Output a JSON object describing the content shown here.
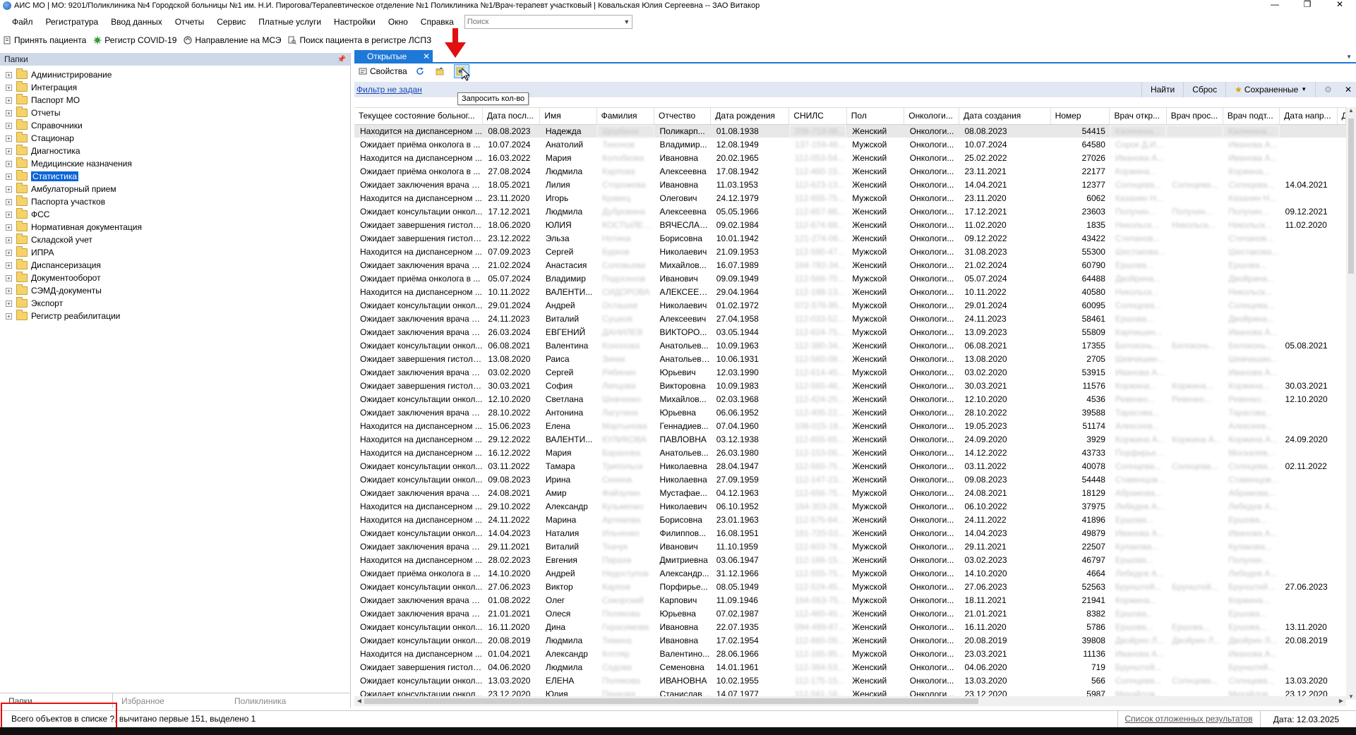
{
  "window": {
    "title": "АИС МО | МО: 9201/Поликлиника №4 Городской больницы №1 им. Н.И. Пирогова/Терапевтическое отделение №1 Поликлиника №1/Врач-терапевт участковый | Ковальская Юлия Сергеевна -- ЗАО Витакор",
    "minimize": "—",
    "maximize": "❐",
    "close": "✕"
  },
  "menu": {
    "items": [
      "Файл",
      "Регистратура",
      "Ввод данных",
      "Отчеты",
      "Сервис",
      "Платные услуги",
      "Настройки",
      "Окно",
      "Справка"
    ],
    "search_placeholder": "Поиск"
  },
  "quickbar": {
    "accept_patient": "Принять пациента",
    "covid_register": "Регистр COVID-19",
    "mse_referral": "Направление на МСЭ",
    "lspz_search": "Поиск пациента в регистре ЛСПЗ"
  },
  "left_pane": {
    "header": "Папки",
    "pin": "ᵖ",
    "folders": [
      "Администрирование",
      "Интеграция",
      "Паспорт МО",
      "Отчеты",
      "Справочники",
      "Стационар",
      "Диагностика",
      "Медицинские назначения",
      "Статистика",
      "Амбулаторный прием",
      "Паспорта участков",
      "ФСС",
      "Нормативная документация",
      "Складской учет",
      "ИПРА",
      "Диспансеризация",
      "Документооборот",
      "СЭМД-документы",
      "Экспорт",
      "Регистр реабилитации"
    ],
    "selected_folder": "Статистика",
    "tabs": [
      "Папки",
      "Избранное",
      "Поликлиника"
    ]
  },
  "right_pane": {
    "tab_label": "Открытые",
    "tab_close": "✕",
    "toolbar": {
      "properties": "Свойства",
      "tooltip": "Запросить кол-во"
    },
    "filter": {
      "link": "Фильтр не задан",
      "find": "Найти",
      "reset": "Сброс",
      "saved": "Сохраненные"
    },
    "columns": [
      "Текущее состояние больног...",
      "Дата посл...",
      "Имя",
      "Фамилия",
      "Отчество",
      "Дата рождения",
      "СНИЛС",
      "Пол",
      "Онкологи...",
      "Дата создания",
      "Номер",
      "Врач откр...",
      "Врач прос...",
      "Врач подт...",
      "Дата напр...",
      "Д"
    ],
    "rows": [
      [
        "Находится на диспансерном ...",
        "08.08.2023",
        "Надежда",
        "Щербина",
        "Поликарп...",
        "01.08.1938",
        "206-719-86...",
        "Женский",
        "Онкологи...",
        "08.08.2023",
        "54415",
        "Калинина...",
        "",
        "Калинина...",
        ""
      ],
      [
        "Ожидает приёма онколога в ...",
        "10.07.2024",
        "Анатолий",
        "Тихонов",
        "Владимир...",
        "12.08.1949",
        "137-159-46...",
        "Мужской",
        "Онкологи...",
        "10.07.2024",
        "64580",
        "Сорок Д.И...",
        "",
        "Иванова А...",
        ""
      ],
      [
        "Находится на диспансерном ...",
        "16.03.2022",
        "Мария",
        "Колобкова",
        "Ивановна",
        "20.02.1965",
        "112-053-54...",
        "Женский",
        "Онкологи...",
        "25.02.2022",
        "27026",
        "Иванова А...",
        "",
        "Иванова А...",
        ""
      ],
      [
        "Ожидает приёма онколога в ...",
        "27.08.2024",
        "Людмила",
        "Карпова",
        "Алексеевна",
        "17.08.1942",
        "112-460-15...",
        "Женский",
        "Онкологи...",
        "23.11.2021",
        "22177",
        "Коржина...",
        "",
        "Коржина...",
        ""
      ],
      [
        "Ожидает заключения врача п...",
        "18.05.2021",
        "Лилия",
        "Сторожева",
        "Ивановна",
        "11.03.1953",
        "112-623-13...",
        "Женский",
        "Онкологи...",
        "14.04.2021",
        "12377",
        "Солнцева...",
        "Солнцева...",
        "Солнцева...",
        "14.04.2021"
      ],
      [
        "Находится на диспансерном ...",
        "23.11.2020",
        "Игорь",
        "Кравец",
        "Олегович",
        "24.12.1979",
        "112-655-75...",
        "Мужской",
        "Онкологи...",
        "23.11.2020",
        "6062",
        "Казанин Н...",
        "",
        "Казанин Н...",
        ""
      ],
      [
        "Ожидает консультации онкол...",
        "17.12.2021",
        "Людмила",
        "Дубровина",
        "Алексеевна",
        "05.05.1966",
        "112-657-86...",
        "Женский",
        "Онкологи...",
        "17.12.2021",
        "23603",
        "Полухин...",
        "Полухин...",
        "Полухин...",
        "09.12.2021"
      ],
      [
        "Ожидает завершения гистоло...",
        "18.06.2020",
        "ЮЛИЯ",
        "КОСТЫЛЕВА",
        "ВЯЧЕСЛАВ...",
        "09.02.1984",
        "112-674-68...",
        "Женский",
        "Онкологи...",
        "11.02.2020",
        "1835",
        "Никольск...",
        "Никольск...",
        "Никольск...",
        "11.02.2020"
      ],
      [
        "Ожидает завершения гистоло...",
        "23.12.2022",
        "Эльза",
        "Нотина",
        "Борисовна",
        "10.01.1942",
        "121-274-06...",
        "Женский",
        "Онкологи...",
        "09.12.2022",
        "43422",
        "Степанов...",
        "",
        "Степанов...",
        ""
      ],
      [
        "Находится на диспансерном ...",
        "07.09.2023",
        "Сергей",
        "Бурков",
        "Николаевич",
        "21.09.1953",
        "112-580-47...",
        "Мужской",
        "Онкологи...",
        "31.08.2023",
        "55300",
        "Шестакова...",
        "",
        "Шестакова...",
        ""
      ],
      [
        "Ожидает заключения врача п...",
        "21.02.2024",
        "Анастасия",
        "Соловьева",
        "Михайлов...",
        "16.07.1989",
        "164-782-34...",
        "Женский",
        "Онкологи...",
        "21.02.2024",
        "60790",
        "Ершова...",
        "",
        "Ершова...",
        ""
      ],
      [
        "Ожидает приёма онколога в ...",
        "05.07.2024",
        "Владимир",
        "Подосенов",
        "Иванович",
        "09.09.1949",
        "112-566-70...",
        "Мужской",
        "Онкологи...",
        "05.07.2024",
        "64488",
        "Двойрина...",
        "",
        "Двойрина...",
        ""
      ],
      [
        "Находится на диспансерном ...",
        "10.11.2022",
        "ВАЛЕНТИ...",
        "СИДОРОВА",
        "АЛЕКСЕЕВ...",
        "29.04.1964",
        "112-188-13...",
        "Женский",
        "Онкологи...",
        "10.11.2022",
        "40580",
        "Никольск...",
        "",
        "Никольск...",
        ""
      ],
      [
        "Ожидает консультации онкол...",
        "29.01.2024",
        "Андрей",
        "Осташев",
        "Николаевич",
        "01.02.1972",
        "072-576-95...",
        "Мужской",
        "Онкологи...",
        "29.01.2024",
        "60095",
        "Солнцева...",
        "",
        "Солнцева...",
        ""
      ],
      [
        "Ожидает заключения врача п...",
        "24.11.2023",
        "Виталий",
        "Сушков",
        "Алексеевич",
        "27.04.1958",
        "112-033-52...",
        "Мужской",
        "Онкологи...",
        "24.11.2023",
        "58461",
        "Ершова...",
        "",
        "Двойрина...",
        ""
      ],
      [
        "Ожидает заключения врача п...",
        "26.03.2024",
        "ЕВГЕНИЙ",
        "ДАНИЛЕВ",
        "ВИКТОРО...",
        "03.05.1944",
        "112-624-75...",
        "Мужской",
        "Онкологи...",
        "13.09.2023",
        "55809",
        "Карпишин...",
        "",
        "Иванова А...",
        ""
      ],
      [
        "Ожидает консультации онкол...",
        "06.08.2021",
        "Валентина",
        "Кононова",
        "Анатольев...",
        "10.09.1963",
        "112-380-34...",
        "Женский",
        "Онкологи...",
        "06.08.2021",
        "17355",
        "Белоконь...",
        "Белоконь...",
        "Белоконь...",
        "05.08.2021"
      ],
      [
        "Ожидает завершения гистоло...",
        "13.08.2020",
        "Раиса",
        "Зиник",
        "Анатольевна",
        "10.06.1931",
        "112-560-08...",
        "Женский",
        "Онкологи...",
        "13.08.2020",
        "2705",
        "Шевчишин...",
        "",
        "Шевчишин...",
        ""
      ],
      [
        "Ожидает заключения врача п...",
        "03.02.2020",
        "Сергей",
        "Рябинин",
        "Юрьевич",
        "12.03.1990",
        "112-614-45...",
        "Мужской",
        "Онкологи...",
        "03.02.2020",
        "53915",
        "Иванова А...",
        "",
        "Иванова А...",
        ""
      ],
      [
        "Ожидает завершения гистоло...",
        "30.03.2021",
        "София",
        "Липцова",
        "Викторовна",
        "10.09.1983",
        "112-565-46...",
        "Женский",
        "Онкологи...",
        "30.03.2021",
        "11576",
        "Коржина...",
        "Коржина...",
        "Коржина...",
        "30.03.2021"
      ],
      [
        "Ожидает консультации онкол...",
        "12.10.2020",
        "Светлана",
        "Шевченко",
        "Михайлов...",
        "02.03.1968",
        "112-424-25...",
        "Женский",
        "Онкологи...",
        "12.10.2020",
        "4536",
        "Ревенко...",
        "Ревенко...",
        "Ревенко...",
        "12.10.2020"
      ],
      [
        "Ожидает заключения врача п...",
        "28.10.2022",
        "Антонина",
        "Лагутина",
        "Юрьевна",
        "06.06.1952",
        "112-405-22...",
        "Женский",
        "Онкологи...",
        "28.10.2022",
        "39588",
        "Тарасова...",
        "",
        "Тарасова...",
        ""
      ],
      [
        "Находится на диспансерном ...",
        "15.06.2023",
        "Елена",
        "Мартынова",
        "Геннадиев...",
        "07.04.1960",
        "108-015-18...",
        "Женский",
        "Онкологи...",
        "19.05.2023",
        "51174",
        "Алексеев...",
        "",
        "Алексеев...",
        ""
      ],
      [
        "Находится на диспансерном ...",
        "29.12.2022",
        "ВАЛЕНТИ...",
        "КУЛИКОВА",
        "ПАВЛОВНА",
        "03.12.1938",
        "112-655-65...",
        "Женский",
        "Онкологи...",
        "24.09.2020",
        "3929",
        "Коржина А...",
        "Коржина А...",
        "Коржина А...",
        "24.09.2020"
      ],
      [
        "Находится на диспансерном ...",
        "16.12.2022",
        "Мария",
        "Баранова",
        "Анатольев...",
        "26.03.1980",
        "112-153-05...",
        "Женский",
        "Онкологи...",
        "14.12.2022",
        "43733",
        "Порфирьев...",
        "",
        "Москалев...",
        ""
      ],
      [
        "Ожидает консультации онкол...",
        "03.11.2022",
        "Тамара",
        "Трипольск",
        "Николаевна",
        "28.04.1947",
        "112-565-75...",
        "Женский",
        "Онкологи...",
        "03.11.2022",
        "40078",
        "Солнцева...",
        "Солнцева...",
        "Солнцева...",
        "02.11.2022"
      ],
      [
        "Ожидает консультации онкол...",
        "09.08.2023",
        "Ирина",
        "Сенина",
        "Николаевна",
        "27.09.1959",
        "112-147-23...",
        "Женский",
        "Онкологи...",
        "09.08.2023",
        "54448",
        "Ставенцова...",
        "",
        "Ставенцова...",
        ""
      ],
      [
        "Ожидает заключения врача п...",
        "24.08.2021",
        "Амир",
        "Файзулин",
        "Мустафае...",
        "04.12.1963",
        "112-656-75...",
        "Мужской",
        "Онкологи...",
        "24.08.2021",
        "18129",
        "Абрамова...",
        "",
        "Абрамова...",
        ""
      ],
      [
        "Находится на диспансерном ...",
        "29.10.2022",
        "Александр",
        "Кузьменко",
        "Николаевич",
        "06.10.1952",
        "164-303-26...",
        "Мужской",
        "Онкологи...",
        "06.10.2022",
        "37975",
        "Лебедев А...",
        "",
        "Лебедев А...",
        ""
      ],
      [
        "Находится на диспансерном ...",
        "24.11.2022",
        "Марина",
        "Артемова",
        "Борисовна",
        "23.01.1963",
        "112-575-64...",
        "Женский",
        "Онкологи...",
        "24.11.2022",
        "41896",
        "Ершова...",
        "",
        "Ершова...",
        ""
      ],
      [
        "Ожидает консультации онкол...",
        "14.04.2023",
        "Наталия",
        "Ильченко",
        "Филиппов...",
        "16.08.1951",
        "181-720-53...",
        "Женский",
        "Онкологи...",
        "14.04.2023",
        "49879",
        "Иванова А...",
        "",
        "Иванова А...",
        ""
      ],
      [
        "Ожидает заключения врача п...",
        "29.11.2021",
        "Виталий",
        "Ткачук",
        "Иванович",
        "11.10.1959",
        "112-603-78...",
        "Мужской",
        "Онкологи...",
        "29.11.2021",
        "22507",
        "Кулакова...",
        "",
        "Кулакова...",
        ""
      ],
      [
        "Находится на диспансерном ...",
        "28.02.2023",
        "Евгения",
        "Парахи",
        "Дмитриевна",
        "03.06.1947",
        "112-166-15...",
        "Женский",
        "Онкологи...",
        "03.02.2023",
        "46797",
        "Ершова...",
        "",
        "Полухин...",
        ""
      ],
      [
        "Ожидает приёма онколога в ...",
        "14.10.2020",
        "Андрей",
        "Недоступов",
        "Александр...",
        "31.12.1966",
        "112-555-75...",
        "Мужской",
        "Онкологи...",
        "14.10.2020",
        "4664",
        "Лебедев А...",
        "",
        "Лебедев А...",
        ""
      ],
      [
        "Ожидает консультации онкол...",
        "27.06.2023",
        "Виктор",
        "Карпов",
        "Порфирье...",
        "08.05.1949",
        "112-524-45...",
        "Мужской",
        "Онкологи...",
        "27.06.2023",
        "52563",
        "Брунштей...",
        "Брунштей...",
        "Брунштей...",
        "27.06.2023"
      ],
      [
        "Ожидает заключения врача п...",
        "01.08.2022",
        "Олег",
        "Сикорский",
        "Карпович",
        "11.09.1946",
        "164-053-75...",
        "Мужской",
        "Онкологи...",
        "18.11.2021",
        "21941",
        "Коржина...",
        "",
        "Коржина...",
        ""
      ],
      [
        "Ожидает заключения врача п...",
        "21.01.2021",
        "Олеся",
        "Полякова",
        "Юрьевна",
        "07.02.1987",
        "112-460-45...",
        "Женский",
        "Онкологи...",
        "21.01.2021",
        "8382",
        "Ершова...",
        "",
        "Ершова...",
        ""
      ],
      [
        "Ожидает консультации онкол...",
        "16.11.2020",
        "Дина",
        "Герасимова",
        "Ивановна",
        "22.07.1935",
        "094-499-87...",
        "Женский",
        "Онкологи...",
        "16.11.2020",
        "5786",
        "Ершова...",
        "Ершова...",
        "Ершова...",
        "13.11.2020"
      ],
      [
        "Ожидает консультации онкол...",
        "20.08.2019",
        "Людмила",
        "Тимина",
        "Ивановна",
        "17.02.1954",
        "112-665-05...",
        "Женский",
        "Онкологи...",
        "20.08.2019",
        "39808",
        "Двойрин Л...",
        "Двойрин Л...",
        "Двойрин Л...",
        "20.08.2019"
      ],
      [
        "Находится на диспансерном ...",
        "01.04.2021",
        "Александр",
        "Котляр",
        "Валентино...",
        "28.06.1966",
        "112-165-95...",
        "Мужской",
        "Онкологи...",
        "23.03.2021",
        "11136",
        "Иванова А...",
        "",
        "Иванова А...",
        ""
      ],
      [
        "Ожидает завершения гистоло...",
        "04.06.2020",
        "Людмила",
        "Седова",
        "Семеновна",
        "14.01.1961",
        "112-384-53...",
        "Женский",
        "Онкологи...",
        "04.06.2020",
        "719",
        "Брунштей...",
        "",
        "Брунштей...",
        ""
      ],
      [
        "Ожидает консультации онкол...",
        "13.03.2020",
        "ЕЛЕНА",
        "Полякова",
        "ИВАНОВНА",
        "10.02.1955",
        "112-175-15...",
        "Женский",
        "Онкологи...",
        "13.03.2020",
        "566",
        "Солнцева...",
        "Солнцева...",
        "Солнцева...",
        "13.03.2020"
      ],
      [
        "Ожидает консультации онкол...",
        "23.12.2020",
        "Юлия",
        "Пенкова",
        "Станиславо...",
        "14.07.1977",
        "112-561-16...",
        "Женский",
        "Онкологи...",
        "23.12.2020",
        "5987",
        "Михайлова...",
        "",
        "Михайлова...",
        "23.12.2020"
      ]
    ],
    "selected_row_index": 0
  },
  "status": {
    "count_text": "Всего объектов в списке ?, вычитано первые 151, выделено 1",
    "deferred_results": "Список отложенных результатов",
    "date": "Дата: 12.03.2025"
  },
  "colors": {
    "accent_blue": "#1e78d7",
    "selection_blue": "#0a64d8",
    "highlight_red": "#e01010",
    "link_blue": "#1b47b6"
  },
  "icons": {
    "app": "app-logo-icon",
    "covid": "virus-icon",
    "referral": "document-icon",
    "register_search": "search-document-icon",
    "properties": "properties-icon",
    "refresh": "refresh-icon",
    "folder_up": "folder-icon",
    "request_count": "request-count-icon",
    "saved": "star-icon"
  }
}
